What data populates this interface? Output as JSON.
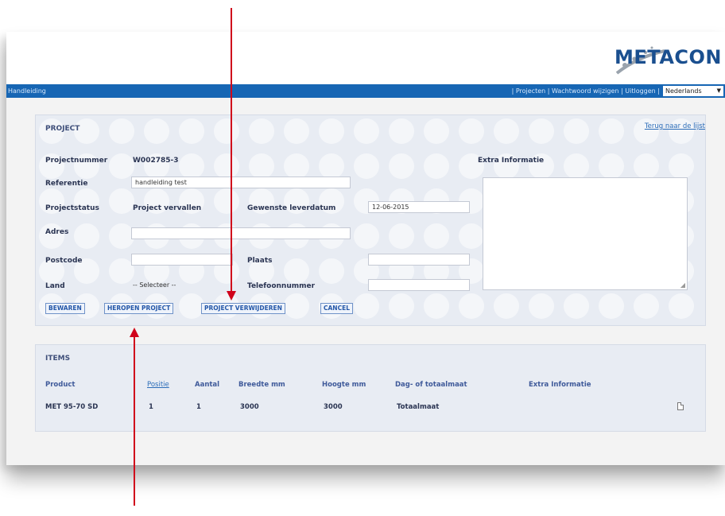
{
  "header": {
    "brand": "METACON"
  },
  "navbar": {
    "left": "Handleiding",
    "links": [
      "Projecten",
      "Wachtwoord wijzigen",
      "Uitloggen"
    ],
    "separator": " | ",
    "language": "Nederlands"
  },
  "project": {
    "section_title": "PROJECT",
    "back_link": "Terug naar de lijst",
    "projectnummer_label": "Projectnummer",
    "projectnummer_value": "W002785-3",
    "referentie_label": "Referentie",
    "referentie_value": "handleiding test",
    "projectstatus_label": "Projectstatus",
    "projectstatus_value": "Project vervallen",
    "leverdatum_label": "Gewenste leverdatum",
    "leverdatum_value": "12-06-2015",
    "adres_label": "Adres",
    "adres_value": "",
    "postcode_label": "Postcode",
    "postcode_value": "",
    "plaats_label": "Plaats",
    "plaats_value": "",
    "land_label": "Land",
    "land_value": "-- Selecteer --",
    "telefoon_label": "Telefoonnummer",
    "telefoon_value": "",
    "extra_label": "Extra Informatie",
    "extra_value": ""
  },
  "buttons": {
    "save": "BEWAREN",
    "reopen": "HEROPEN PROJECT",
    "delete": "PROJECT VERWIJDEREN",
    "cancel": "CANCEL"
  },
  "items": {
    "section_title": "ITEMS",
    "columns": [
      "Product",
      "Positie",
      "Aantal",
      "Breedte mm",
      "Hoogte mm",
      "Dag- of totaalmaat",
      "Extra Informatie"
    ],
    "rows": [
      {
        "product": "MET 95-70 SD",
        "positie": "1",
        "aantal": "1",
        "breedte": "3000",
        "hoogte": "3000",
        "maat": "Totaalmaat",
        "extra": ""
      }
    ]
  },
  "colors": {
    "nav_bar": "#1766b4",
    "arrow": "#d0021b",
    "panel": "#e8ecf3"
  }
}
